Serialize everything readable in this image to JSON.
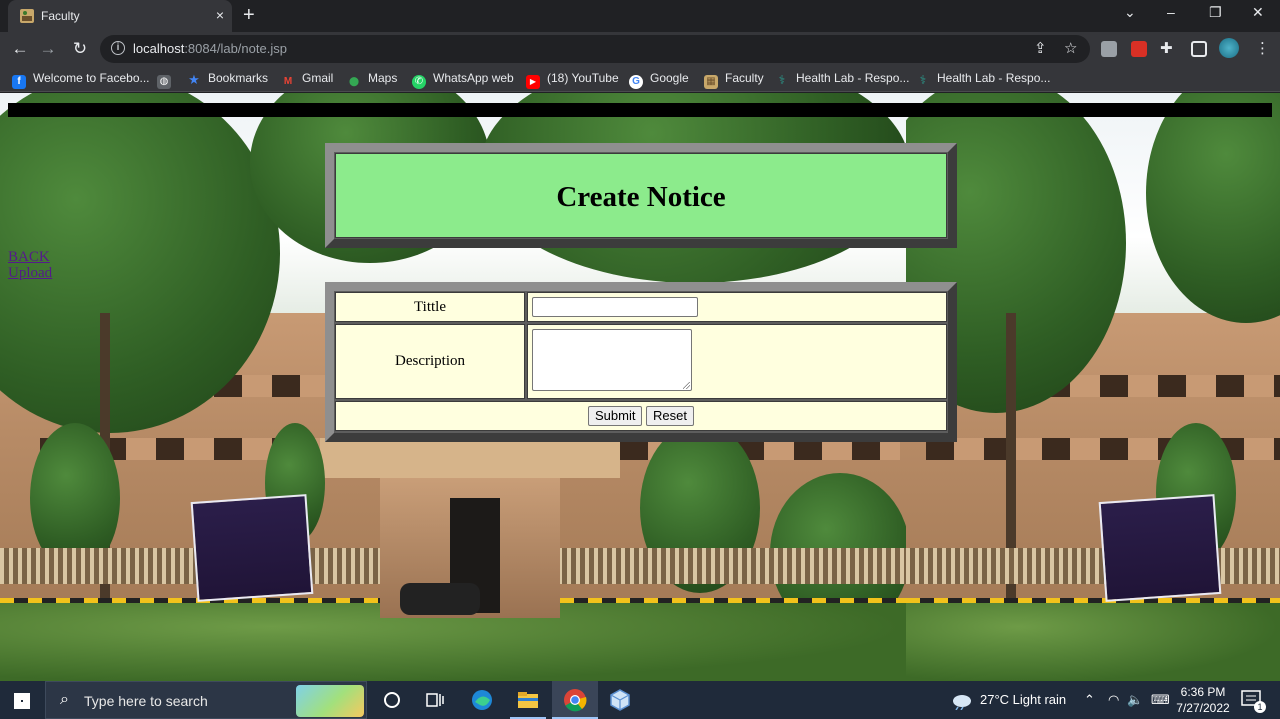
{
  "browser": {
    "tab_title": "Faculty",
    "tab_close": "×",
    "new_tab": "+",
    "url_host": "localhost",
    "url_path": ":8084/lab/note.jsp",
    "window_controls": {
      "chevron": "⌄",
      "minimize": "–",
      "restore": "❐",
      "close": "✕"
    },
    "bookmarks": [
      {
        "label": "Welcome to Facebo...",
        "icon": "facebook-icon",
        "color": "#1877f2",
        "glyph": "f"
      },
      {
        "label": "",
        "icon": "globe-icon",
        "color": "#9aa0a6",
        "glyph": "◍"
      },
      {
        "label": "Bookmarks",
        "icon": "star-icon",
        "color": "#4285f4",
        "glyph": "★"
      },
      {
        "label": "Gmail",
        "icon": "gmail-icon",
        "color": "#ea4335",
        "glyph": "M"
      },
      {
        "label": "Maps",
        "icon": "maps-icon",
        "color": "#34a853",
        "glyph": "⬤"
      },
      {
        "label": "WhatsApp web",
        "icon": "whatsapp-icon",
        "color": "#25d366",
        "glyph": "✆"
      },
      {
        "label": "(18) YouTube",
        "icon": "youtube-icon",
        "color": "#ff0000",
        "glyph": "▶"
      },
      {
        "label": "Google",
        "icon": "google-icon",
        "color": "#ffffff",
        "glyph": "G"
      },
      {
        "label": "Faculty",
        "icon": "faculty-icon",
        "color": "#c8a86a",
        "glyph": "▦"
      },
      {
        "label": "Health Lab - Respo...",
        "icon": "health-lab-icon",
        "color": "#2a9d8f",
        "glyph": "⚕"
      },
      {
        "label": "Health Lab - Respo...",
        "icon": "health-lab-icon",
        "color": "#2a9d8f",
        "glyph": "⚕"
      }
    ]
  },
  "page": {
    "links": {
      "back": "BACK",
      "upload": "Upload"
    },
    "heading": "Create Notice",
    "form": {
      "title_label": "Tittle",
      "title_value": "",
      "description_label": "Description",
      "description_value": "",
      "submit_label": "Submit",
      "reset_label": "Reset"
    },
    "colors": {
      "title_bg": "#8ceb8c",
      "form_bg": "#ffffdf",
      "frame": "#5d5d5d"
    }
  },
  "taskbar": {
    "search_placeholder": "Type here to search",
    "weather": "27°C  Light rain",
    "time": "6:36 PM",
    "date": "7/27/2022",
    "notification_count": "1"
  }
}
